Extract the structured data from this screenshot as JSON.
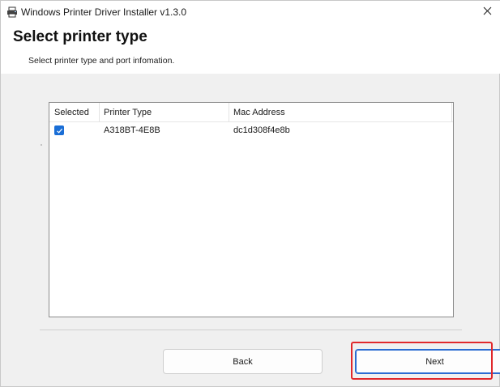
{
  "window": {
    "title": "Windows Printer Driver Installer v1.3.0"
  },
  "header": {
    "title": "Select printer type",
    "subtitle": "Select printer type and port infomation."
  },
  "printer_list": {
    "columns": [
      "Selected",
      "Printer Type",
      "Mac Address"
    ],
    "rows": [
      {
        "selected": true,
        "printer_type": "A318BT-4E8B",
        "mac_address": "dc1d308f4e8b"
      }
    ]
  },
  "buttons": {
    "back_label": "Back",
    "next_label": "Next"
  },
  "colors": {
    "accent": "#1a6ed6",
    "highlight": "#e0282b"
  },
  "icons": {
    "app": "printer-icon",
    "close": "close-icon",
    "check": "checkmark-icon"
  }
}
